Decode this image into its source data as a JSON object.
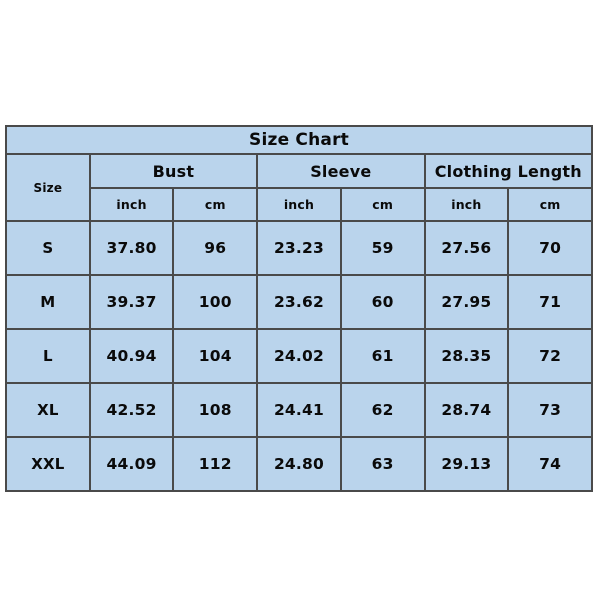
{
  "chart_data": {
    "type": "table",
    "title": "Size Chart",
    "size_header": "Size",
    "groups": [
      {
        "label": "Bust",
        "units": [
          "inch",
          "cm"
        ]
      },
      {
        "label": "Sleeve",
        "units": [
          "inch",
          "cm"
        ]
      },
      {
        "label": "Clothing Length",
        "units": [
          "inch",
          "cm"
        ]
      }
    ],
    "columns": [
      "Size",
      "Bust inch",
      "Bust cm",
      "Sleeve inch",
      "Sleeve cm",
      "Clothing Length inch",
      "Clothing Length cm"
    ],
    "rows": [
      {
        "size": "S",
        "bust_inch": "37.80",
        "bust_cm": "96",
        "sleeve_inch": "23.23",
        "sleeve_cm": "59",
        "length_inch": "27.56",
        "length_cm": "70"
      },
      {
        "size": "M",
        "bust_inch": "39.37",
        "bust_cm": "100",
        "sleeve_inch": "23.62",
        "sleeve_cm": "60",
        "length_inch": "27.95",
        "length_cm": "71"
      },
      {
        "size": "L",
        "bust_inch": "40.94",
        "bust_cm": "104",
        "sleeve_inch": "24.02",
        "sleeve_cm": "61",
        "length_inch": "28.35",
        "length_cm": "72"
      },
      {
        "size": "XL",
        "bust_inch": "42.52",
        "bust_cm": "108",
        "sleeve_inch": "24.41",
        "sleeve_cm": "62",
        "length_inch": "28.74",
        "length_cm": "73"
      },
      {
        "size": "XXL",
        "bust_inch": "44.09",
        "bust_cm": "112",
        "sleeve_inch": "24.80",
        "sleeve_cm": "63",
        "length_inch": "29.13",
        "length_cm": "74"
      }
    ],
    "colors": {
      "header_background": "#bad4ec",
      "data_background": "#ffc20e",
      "border": "#4a4a4a",
      "text": "#0a0a0a",
      "page_background": "#ffffff"
    }
  }
}
